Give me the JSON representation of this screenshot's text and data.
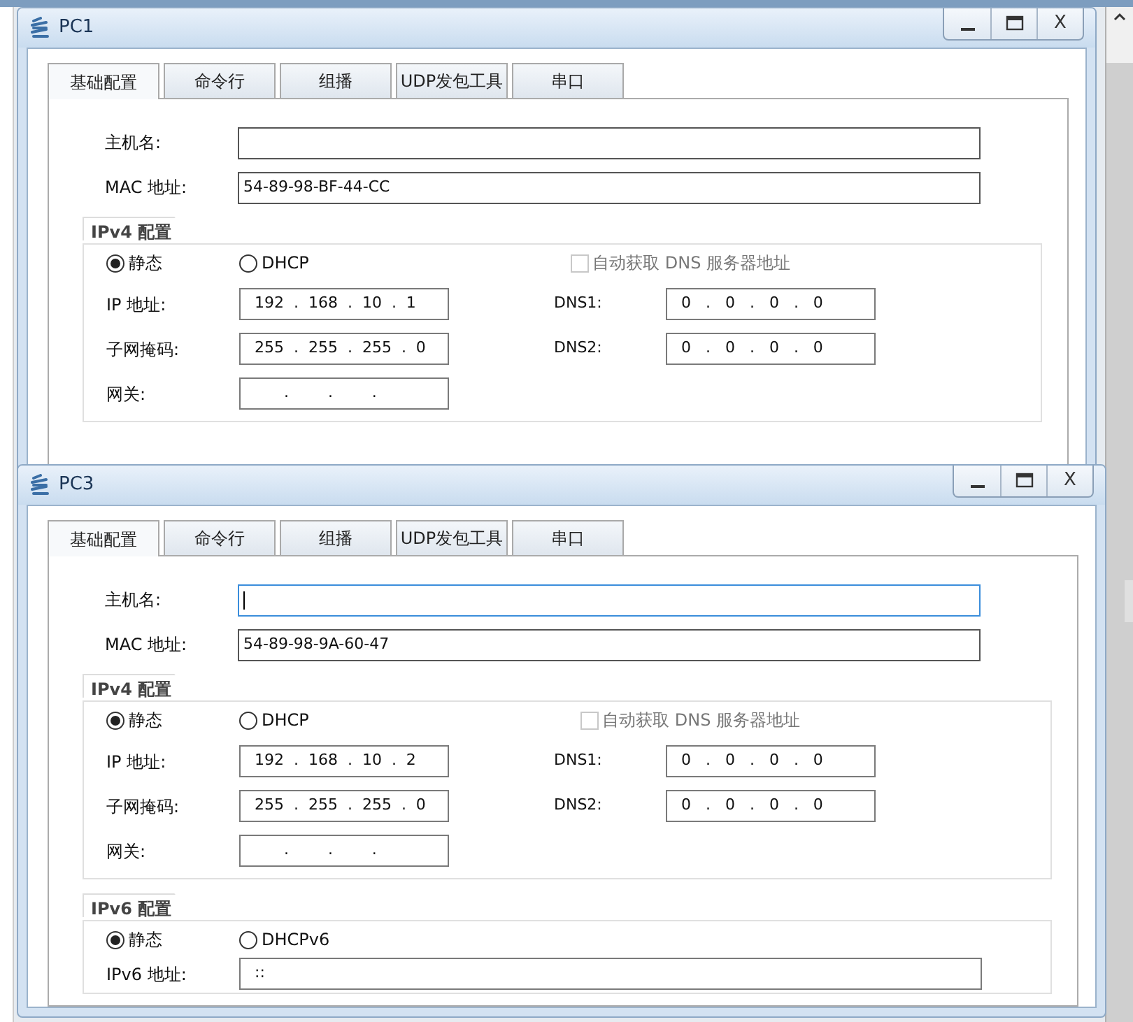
{
  "windows": [
    {
      "title": "PC1",
      "close": "X",
      "tabs": [
        {
          "label": "基础配置",
          "selected": true
        },
        {
          "label": "命令行",
          "selected": false
        },
        {
          "label": "组播",
          "selected": false
        },
        {
          "label": "UDP发包工具",
          "selected": false
        },
        {
          "label": "串口",
          "selected": false
        }
      ],
      "hostname": {
        "label": "主机名:",
        "focused": false
      },
      "mac": {
        "label": "MAC 地址:",
        "value": "54-89-98-BF-44-CC"
      },
      "ipv4": {
        "legend": "IPv4 配置",
        "modes": [
          {
            "label": "静态",
            "selected": true
          },
          {
            "label": "DHCP",
            "selected": false
          }
        ],
        "auto_dns": {
          "label": "自动获取 DNS 服务器地址",
          "checked": false,
          "disabled": true
        },
        "fields": [
          {
            "label": "IP 地址:",
            "value": "192  .  168  .  10  .  1"
          },
          {
            "label": "子网掩码:",
            "value": "255  .  255  .  255  .  0"
          },
          {
            "label": "网关:",
            "value": "      .        .        ."
          }
        ],
        "dns": [
          {
            "label": "DNS1:",
            "value": "0   .   0   .   0   .   0"
          },
          {
            "label": "DNS2:",
            "value": "0   .   0   .   0   .   0"
          }
        ]
      }
    },
    {
      "title": "PC3",
      "close": "X",
      "tabs": [
        {
          "label": "基础配置",
          "selected": true
        },
        {
          "label": "命令行",
          "selected": false
        },
        {
          "label": "组播",
          "selected": false
        },
        {
          "label": "UDP发包工具",
          "selected": false
        },
        {
          "label": "串口",
          "selected": false
        }
      ],
      "hostname": {
        "label": "主机名:",
        "focused": true
      },
      "mac": {
        "label": "MAC 地址:",
        "value": "54-89-98-9A-60-47"
      },
      "ipv4": {
        "legend": "IPv4 配置",
        "modes": [
          {
            "label": "静态",
            "selected": true
          },
          {
            "label": "DHCP",
            "selected": false
          }
        ],
        "auto_dns": {
          "label": "自动获取 DNS 服务器地址",
          "checked": false,
          "disabled": true
        },
        "fields": [
          {
            "label": "IP 地址:",
            "value": "192  .  168  .  10  .  2"
          },
          {
            "label": "子网掩码:",
            "value": "255  .  255  .  255  .  0"
          },
          {
            "label": "网关:",
            "value": "      .        .        ."
          }
        ],
        "dns": [
          {
            "label": "DNS1:",
            "value": "0   .   0   .   0   .   0"
          },
          {
            "label": "DNS2:",
            "value": "0   .   0   .   0   .   0"
          }
        ]
      },
      "ipv6": {
        "legend": "IPv6 配置",
        "modes": [
          {
            "label": "静态",
            "selected": true
          },
          {
            "label": "DHCPv6",
            "selected": false
          }
        ],
        "fields": [
          {
            "label": "IPv6 地址:",
            "value": "::"
          }
        ]
      }
    }
  ]
}
